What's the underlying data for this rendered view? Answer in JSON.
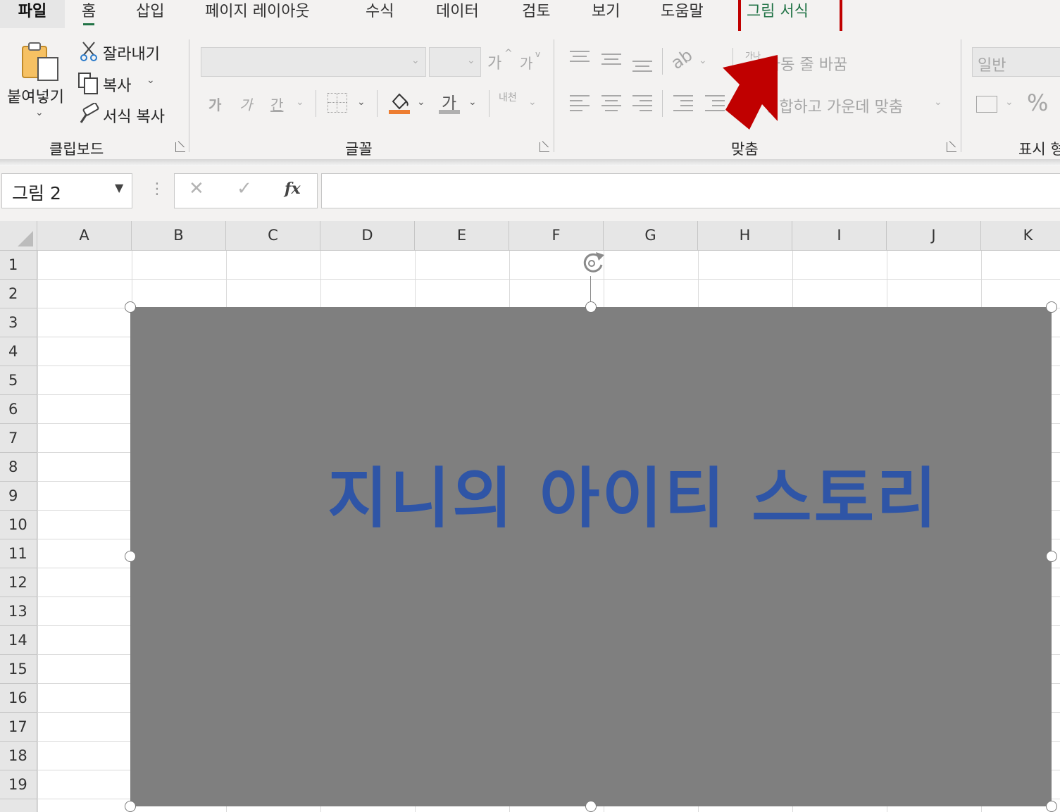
{
  "tabs": {
    "file": "파일",
    "home": "홈",
    "insert": "삽입",
    "page_layout": "페이지 레이아웃",
    "formulas": "수식",
    "data": "데이터",
    "review": "검토",
    "view": "보기",
    "help": "도움말",
    "picture_format": "그림 서식"
  },
  "clipboard": {
    "paste": "붙여넣기",
    "cut": "잘라내기",
    "copy": "복사",
    "format_painter": "서식 복사",
    "group_label": "클립보드"
  },
  "font": {
    "grow_font": "가",
    "shrink_font": "가",
    "bold": "가",
    "italic": "가",
    "underline": "간",
    "font_color_glyph": "가",
    "phonetic": "내천",
    "group_label": "글꼴"
  },
  "alignment": {
    "wrap_text": "자동 줄 바꿈",
    "wrap_icon_text": "가나",
    "merge_center": "병합하고 가운데 맞춤",
    "group_label": "맞춤"
  },
  "number": {
    "format_value": "일반",
    "percent": "%",
    "group_label": "표시 형"
  },
  "formula_bar": {
    "name_box": "그림 2",
    "fx": "fx"
  },
  "sheet": {
    "columns": [
      "A",
      "B",
      "C",
      "D",
      "E",
      "F",
      "G",
      "H",
      "I",
      "J",
      "K"
    ],
    "rows": [
      "1",
      "2",
      "3",
      "4",
      "5",
      "6",
      "7",
      "8",
      "9",
      "10",
      "11",
      "12",
      "13",
      "14",
      "15",
      "16",
      "17",
      "18",
      "19"
    ]
  },
  "picture": {
    "text": "지니의 아이티 스토리",
    "fill_color": "#7f7f7f",
    "text_color": "#2f55a6"
  },
  "annotation": {
    "box_color": "#c00000",
    "arrow_color": "#c00000"
  }
}
